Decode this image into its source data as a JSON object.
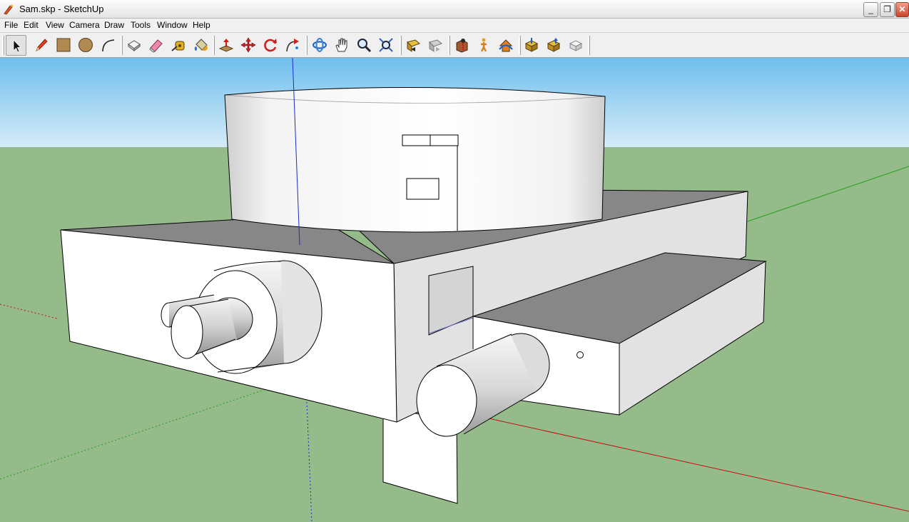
{
  "window": {
    "title": "Sam.skp - SketchUp",
    "minimize_label": "_",
    "restore_label": "❐",
    "close_label": "✕"
  },
  "menu": {
    "items": [
      {
        "label": "File"
      },
      {
        "label": "Edit"
      },
      {
        "label": "View"
      },
      {
        "label": "Camera"
      },
      {
        "label": "Draw"
      },
      {
        "label": "Tools"
      },
      {
        "label": "Window"
      },
      {
        "label": "Help"
      }
    ]
  },
  "toolbar": {
    "tools": [
      {
        "name": "select-tool",
        "icon": "arrow-cursor-icon",
        "active": true
      },
      {
        "name": "pencil-tool",
        "icon": "pencil-icon"
      },
      {
        "name": "rectangle-tool",
        "icon": "rectangle-icon"
      },
      {
        "name": "circle-tool",
        "icon": "circle-icon"
      },
      {
        "name": "arc-tool",
        "icon": "arc-icon"
      },
      {
        "name": "make-component-tool",
        "icon": "component-icon"
      },
      {
        "name": "eraser-tool",
        "icon": "eraser-icon"
      },
      {
        "name": "tape-measure-tool",
        "icon": "tape-measure-icon"
      },
      {
        "name": "paint-bucket-tool",
        "icon": "paint-bucket-icon"
      },
      {
        "name": "push-pull-tool",
        "icon": "push-pull-icon"
      },
      {
        "name": "move-tool",
        "icon": "move-icon"
      },
      {
        "name": "rotate-tool",
        "icon": "rotate-icon"
      },
      {
        "name": "follow-me-tool",
        "icon": "follow-me-icon"
      },
      {
        "name": "orbit-tool",
        "icon": "orbit-icon"
      },
      {
        "name": "pan-tool",
        "icon": "hand-icon"
      },
      {
        "name": "zoom-tool",
        "icon": "magnifier-icon"
      },
      {
        "name": "zoom-extents-tool",
        "icon": "zoom-extents-icon"
      },
      {
        "name": "previous-view-tool",
        "icon": "previous-view-icon"
      },
      {
        "name": "next-view-tool",
        "icon": "next-view-icon"
      },
      {
        "name": "position-camera-tool",
        "icon": "position-camera-icon"
      },
      {
        "name": "walk-tool",
        "icon": "walk-icon"
      },
      {
        "name": "look-around-tool",
        "icon": "look-around-icon"
      },
      {
        "name": "get-models-tool",
        "icon": "get-models-icon"
      },
      {
        "name": "share-model-tool",
        "icon": "share-model-icon"
      },
      {
        "name": "share-component-tool",
        "icon": "share-component-icon"
      }
    ]
  },
  "colors": {
    "sky_top": "#6fbfee",
    "sky_bottom": "#d6ecf8",
    "ground": "#96bb8a",
    "red_axis": "#c01010",
    "green_axis": "#1ca01c",
    "blue_axis": "#1c2ccc",
    "shadow_face": "#878787"
  }
}
